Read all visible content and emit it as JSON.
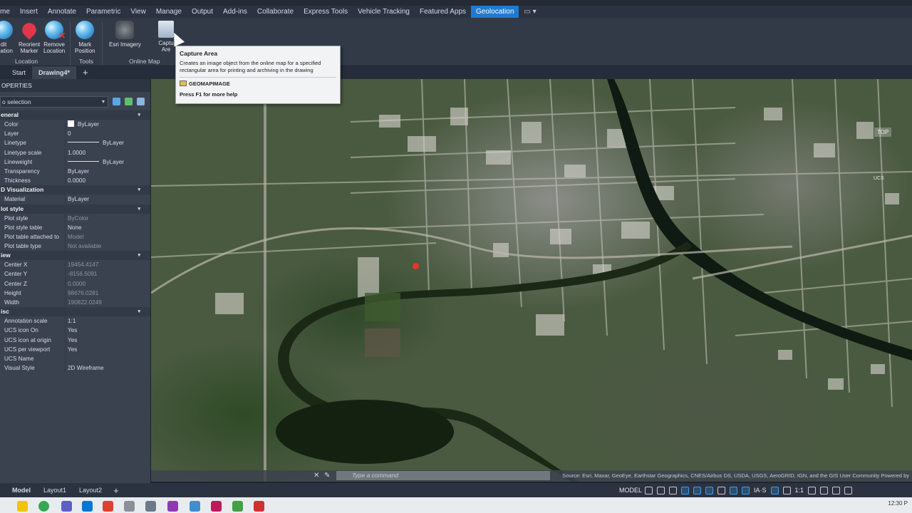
{
  "menu": {
    "items": [
      "me",
      "Insert",
      "Annotate",
      "Parametric",
      "View",
      "Manage",
      "Output",
      "Add-ins",
      "Collaborate",
      "Express Tools",
      "Vehicle Tracking",
      "Featured Apps",
      "Geolocation"
    ],
    "active": "Geolocation"
  },
  "ribbon": {
    "buttons": {
      "edit_location": "dit\nocation",
      "reorient_marker": "Reorient\nMarker",
      "remove_location": "Remove\nLocation",
      "mark_position": "Mark\nPosition",
      "esri_imagery": "Esri Imagery",
      "capture_area": "Captu\nAre"
    },
    "panels": {
      "location": "Location",
      "tools": "Tools",
      "online_map": "Online Map"
    }
  },
  "tabs": {
    "start": "Start",
    "drawing": "Drawing4*",
    "add": "+"
  },
  "tooltip": {
    "title": "Capture Area",
    "description": "Creates an image object from the online map for a specified rectangular area for printing and archiving in the drawing",
    "command": "GEOMAPIMAGE",
    "help": "Press F1 for more help"
  },
  "properties": {
    "header": "OPERTIES",
    "selection": "o selection",
    "groups": {
      "general": "eneral",
      "visualization": "D Visualization",
      "plot_style": "lot style",
      "view": "iew",
      "misc": "isc"
    },
    "general_rows": [
      {
        "key": "Color",
        "value": "ByLayer"
      },
      {
        "key": "Layer",
        "value": "0"
      },
      {
        "key": "Linetype",
        "value": "ByLayer"
      },
      {
        "key": "Linetype scale",
        "value": "1.0000"
      },
      {
        "key": "Lineweight",
        "value": "ByLayer"
      },
      {
        "key": "Transparency",
        "value": "ByLayer"
      },
      {
        "key": "Thickness",
        "value": "0.0000"
      }
    ],
    "visualization_rows": [
      {
        "key": "Material",
        "value": "ByLayer"
      }
    ],
    "plot_rows": [
      {
        "key": "Plot style",
        "value": "ByColor"
      },
      {
        "key": "Plot style table",
        "value": "None"
      },
      {
        "key": "Plot table attached to",
        "value": "Model"
      },
      {
        "key": "Plot table type",
        "value": "Not available"
      }
    ],
    "view_rows": [
      {
        "key": "Center X",
        "value": "19454.4147"
      },
      {
        "key": "Center Y",
        "value": "-8156.5091"
      },
      {
        "key": "Center Z",
        "value": "0.0000"
      },
      {
        "key": "Height",
        "value": "98676.0281"
      },
      {
        "key": "Width",
        "value": "190822.0249"
      }
    ],
    "misc_rows": [
      {
        "key": "Annotation scale",
        "value": "1:1"
      },
      {
        "key": "UCS icon On",
        "value": "Yes"
      },
      {
        "key": "UCS icon at origin",
        "value": "Yes"
      },
      {
        "key": "UCS per viewport",
        "value": "Yes"
      },
      {
        "key": "UCS Name",
        "value": ""
      },
      {
        "key": "Visual Style",
        "value": "2D Wireframe"
      }
    ]
  },
  "map": {
    "viewcube": "TOP",
    "ucs": "UCS",
    "command_placeholder": "Type a command",
    "attribution": "Source: Esri, Maxar, GeoEye, Earthstar Geographics, CNES/Airbus DS, USDA, USGS, AeroGRID, IGN, and the GIS User Community Powered by"
  },
  "statusbar": {
    "layouts": [
      "Model",
      "Layout1",
      "Layout2"
    ],
    "add": "+",
    "model": "MODEL",
    "scale": "1:1",
    "ia": "IA·S"
  },
  "taskbar": {
    "time": "12:30 P"
  }
}
